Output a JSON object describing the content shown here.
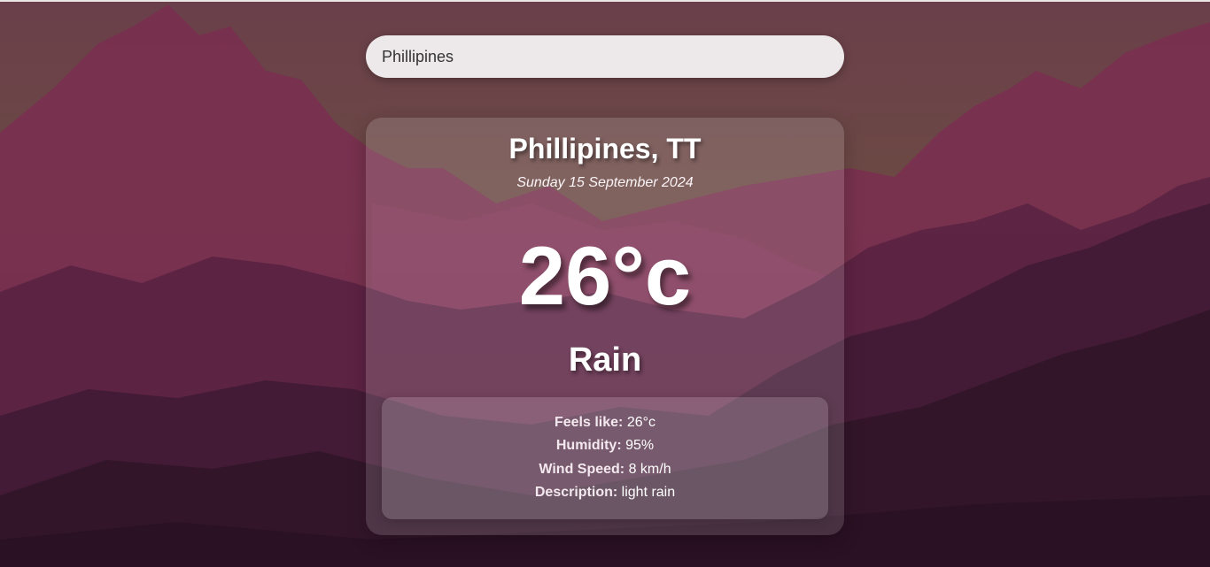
{
  "search": {
    "value": "Phillipines",
    "placeholder": ""
  },
  "weather": {
    "location": "Phillipines, TT",
    "date": "Sunday 15 September 2024",
    "temperature": "26°c",
    "condition": "Rain"
  },
  "details": [
    {
      "label": "Feels like:",
      "value": "26°c"
    },
    {
      "label": "Humidity:",
      "value": "95%"
    },
    {
      "label": "Wind Speed:",
      "value": "8 km/h"
    },
    {
      "label": "Description:",
      "value": "light rain"
    }
  ],
  "colors": {
    "sky_top": "#6a4848",
    "mountain_far": "#7a3456",
    "mountain_mid": "#5a2242",
    "mountain_near": "#3e1a33",
    "mountain_front": "#2e1428"
  }
}
